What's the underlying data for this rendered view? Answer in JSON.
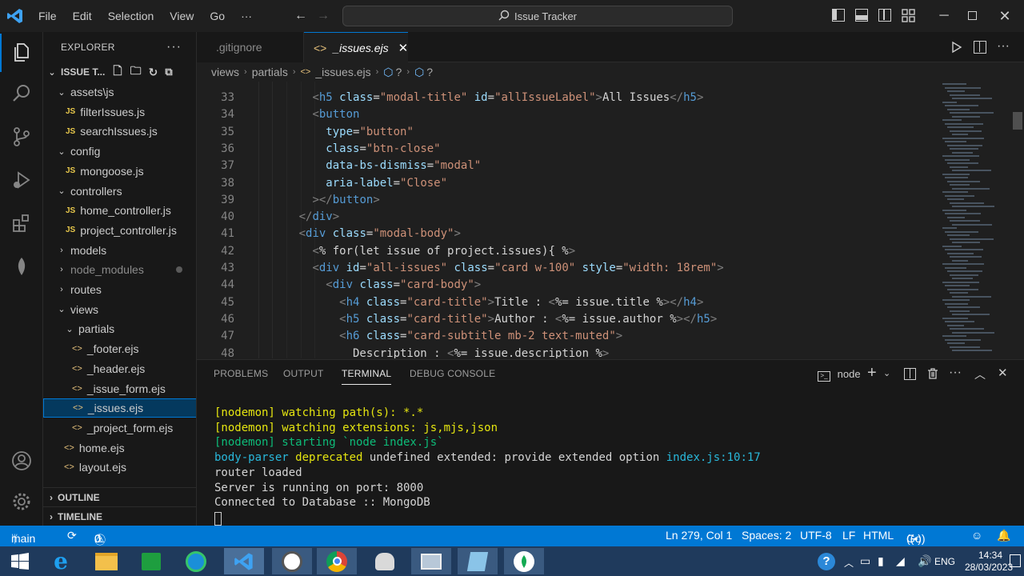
{
  "window": {
    "title": "Issue Tracker",
    "menu": [
      "File",
      "Edit",
      "Selection",
      "View",
      "Go",
      "···"
    ]
  },
  "explorer": {
    "header": "EXPLORER",
    "project": "ISSUE T...",
    "tree": [
      {
        "label": "assets\\js",
        "indent": 1,
        "kind": "folder-open"
      },
      {
        "label": "filterIssues.js",
        "indent": 2,
        "kind": "js"
      },
      {
        "label": "searchIssues.js",
        "indent": 2,
        "kind": "js"
      },
      {
        "label": "config",
        "indent": 1,
        "kind": "folder-open"
      },
      {
        "label": "mongoose.js",
        "indent": 2,
        "kind": "js"
      },
      {
        "label": "controllers",
        "indent": 1,
        "kind": "folder-open"
      },
      {
        "label": "home_controller.js",
        "indent": 2,
        "kind": "js"
      },
      {
        "label": "project_controller.js",
        "indent": 2,
        "kind": "js"
      },
      {
        "label": "models",
        "indent": 1,
        "kind": "folder-closed"
      },
      {
        "label": "node_modules",
        "indent": 1,
        "kind": "folder-closed-dim"
      },
      {
        "label": "routes",
        "indent": 1,
        "kind": "folder-closed"
      },
      {
        "label": "views",
        "indent": 1,
        "kind": "folder-open"
      },
      {
        "label": "partials",
        "indent": 2,
        "kind": "folder-open"
      },
      {
        "label": "_footer.ejs",
        "indent": 3,
        "kind": "ejs"
      },
      {
        "label": "_header.ejs",
        "indent": 3,
        "kind": "ejs"
      },
      {
        "label": "_issue_form.ejs",
        "indent": 3,
        "kind": "ejs"
      },
      {
        "label": "_issues.ejs",
        "indent": 3,
        "kind": "ejs-selected"
      },
      {
        "label": "_project_form.ejs",
        "indent": 3,
        "kind": "ejs"
      },
      {
        "label": "home.ejs",
        "indent": 2,
        "kind": "ejs"
      },
      {
        "label": "layout.ejs",
        "indent": 2,
        "kind": "ejs"
      }
    ],
    "outline": "OUTLINE",
    "timeline": "TIMELINE"
  },
  "tabs": [
    {
      "label": ".gitignore"
    },
    {
      "label": "_issues.ejs"
    }
  ],
  "breadcrumb": [
    "views",
    "partials",
    "_issues.ejs",
    "?",
    "?"
  ],
  "code": [
    {
      "n": "33",
      "parts": [
        [
          "tx",
          "        "
        ],
        [
          "br",
          "<"
        ],
        [
          "tg",
          "h5"
        ],
        [
          "at",
          " class"
        ],
        [
          "tx",
          "="
        ],
        [
          "st",
          "\"modal-title\""
        ],
        [
          "at",
          " id"
        ],
        [
          "tx",
          "="
        ],
        [
          "st",
          "\"allIssueLabel\""
        ],
        [
          "br",
          ">"
        ],
        [
          "tx",
          "All Issues"
        ],
        [
          "br",
          "</"
        ],
        [
          "tg",
          "h5"
        ],
        [
          "br",
          ">"
        ]
      ]
    },
    {
      "n": "34",
      "parts": [
        [
          "tx",
          "        "
        ],
        [
          "br",
          "<"
        ],
        [
          "tg",
          "button"
        ]
      ]
    },
    {
      "n": "35",
      "parts": [
        [
          "tx",
          "          "
        ],
        [
          "at",
          "type"
        ],
        [
          "tx",
          "="
        ],
        [
          "st",
          "\"button\""
        ]
      ]
    },
    {
      "n": "36",
      "parts": [
        [
          "tx",
          "          "
        ],
        [
          "at",
          "class"
        ],
        [
          "tx",
          "="
        ],
        [
          "st",
          "\"btn-close\""
        ]
      ]
    },
    {
      "n": "37",
      "parts": [
        [
          "tx",
          "          "
        ],
        [
          "at",
          "data-bs-dismiss"
        ],
        [
          "tx",
          "="
        ],
        [
          "st",
          "\"modal\""
        ]
      ]
    },
    {
      "n": "38",
      "parts": [
        [
          "tx",
          "          "
        ],
        [
          "at",
          "aria-label"
        ],
        [
          "tx",
          "="
        ],
        [
          "st",
          "\"Close\""
        ]
      ]
    },
    {
      "n": "39",
      "parts": [
        [
          "tx",
          "        "
        ],
        [
          "br",
          "></"
        ],
        [
          "tg",
          "button"
        ],
        [
          "br",
          ">"
        ]
      ]
    },
    {
      "n": "40",
      "parts": [
        [
          "tx",
          "      "
        ],
        [
          "br",
          "</"
        ],
        [
          "tg",
          "div"
        ],
        [
          "br",
          ">"
        ]
      ]
    },
    {
      "n": "41",
      "parts": [
        [
          "tx",
          "      "
        ],
        [
          "br",
          "<"
        ],
        [
          "tg",
          "div"
        ],
        [
          "at",
          " class"
        ],
        [
          "tx",
          "="
        ],
        [
          "st",
          "\"modal-body\""
        ],
        [
          "br",
          ">"
        ]
      ]
    },
    {
      "n": "42",
      "parts": [
        [
          "tx",
          "        "
        ],
        [
          "br",
          "<"
        ],
        [
          "tx",
          "% for(let issue of project.issues){ %"
        ],
        [
          "br",
          ">"
        ]
      ]
    },
    {
      "n": "43",
      "parts": [
        [
          "tx",
          "        "
        ],
        [
          "br",
          "<"
        ],
        [
          "tg",
          "div"
        ],
        [
          "at",
          " id"
        ],
        [
          "tx",
          "="
        ],
        [
          "st",
          "\"all-issues\""
        ],
        [
          "at",
          " class"
        ],
        [
          "tx",
          "="
        ],
        [
          "st",
          "\"card w-100\""
        ],
        [
          "at",
          " style"
        ],
        [
          "tx",
          "="
        ],
        [
          "st",
          "\"width: 18rem\""
        ],
        [
          "br",
          ">"
        ]
      ]
    },
    {
      "n": "44",
      "parts": [
        [
          "tx",
          "          "
        ],
        [
          "br",
          "<"
        ],
        [
          "tg",
          "div"
        ],
        [
          "at",
          " class"
        ],
        [
          "tx",
          "="
        ],
        [
          "st",
          "\"card-body\""
        ],
        [
          "br",
          ">"
        ]
      ]
    },
    {
      "n": "45",
      "parts": [
        [
          "tx",
          "            "
        ],
        [
          "br",
          "<"
        ],
        [
          "tg",
          "h4"
        ],
        [
          "at",
          " class"
        ],
        [
          "tx",
          "="
        ],
        [
          "st",
          "\"card-title\""
        ],
        [
          "br",
          ">"
        ],
        [
          "tx",
          "Title : "
        ],
        [
          "br",
          "<"
        ],
        [
          "tx",
          "%= issue.title %"
        ],
        [
          "br",
          "></"
        ],
        [
          "tg",
          "h4"
        ],
        [
          "br",
          ">"
        ]
      ]
    },
    {
      "n": "46",
      "parts": [
        [
          "tx",
          "            "
        ],
        [
          "br",
          "<"
        ],
        [
          "tg",
          "h5"
        ],
        [
          "at",
          " class"
        ],
        [
          "tx",
          "="
        ],
        [
          "st",
          "\"card-title\""
        ],
        [
          "br",
          ">"
        ],
        [
          "tx",
          "Author : "
        ],
        [
          "br",
          "<"
        ],
        [
          "tx",
          "%= issue.author %"
        ],
        [
          "br",
          "></"
        ],
        [
          "tg",
          "h5"
        ],
        [
          "br",
          ">"
        ]
      ]
    },
    {
      "n": "47",
      "parts": [
        [
          "tx",
          "            "
        ],
        [
          "br",
          "<"
        ],
        [
          "tg",
          "h6"
        ],
        [
          "at",
          " class"
        ],
        [
          "tx",
          "="
        ],
        [
          "st",
          "\"card-subtitle mb-2 text-muted\""
        ],
        [
          "br",
          ">"
        ]
      ]
    },
    {
      "n": "48",
      "parts": [
        [
          "tx",
          "              Description : "
        ],
        [
          "br",
          "<"
        ],
        [
          "tx",
          "%= issue.description %"
        ],
        [
          "br",
          ">"
        ]
      ]
    }
  ],
  "panel": {
    "tabs": [
      "PROBLEMS",
      "OUTPUT",
      "TERMINAL",
      "DEBUG CONSOLE"
    ],
    "active_tab": "TERMINAL",
    "shell": "node",
    "terminal": [
      {
        "parts": [
          [
            "yl",
            "[nodemon] watching path(s): *.*"
          ]
        ]
      },
      {
        "parts": [
          [
            "yl",
            "[nodemon] watching extensions: js,mjs,json"
          ]
        ]
      },
      {
        "parts": [
          [
            "gr",
            "[nodemon] starting `node index.js`"
          ]
        ]
      },
      {
        "parts": [
          [
            "cy",
            "body-parser"
          ],
          [
            "yl",
            " deprecated"
          ],
          [
            "tx",
            " undefined extended: provide extended option "
          ],
          [
            "cy",
            "index.js:10:17"
          ]
        ]
      },
      {
        "parts": [
          [
            "tx",
            "router loaded"
          ]
        ]
      },
      {
        "parts": [
          [
            "tx",
            "Server is running on port: 8000"
          ]
        ]
      },
      {
        "parts": [
          [
            "tx",
            "Connected to Database :: MongoDB"
          ]
        ]
      }
    ]
  },
  "statusbar": {
    "branch": "main",
    "errors": "0",
    "warnings": "0",
    "position": "Ln 279, Col 1",
    "spaces": "Spaces: 2",
    "encoding": "UTF-8",
    "eol": "LF",
    "language": "HTML",
    "golive": "Go Live"
  },
  "taskbar": {
    "lang": "ENG",
    "time": "14:34",
    "date": "28/03/2023"
  },
  "colors": {
    "accent": "#0078d4",
    "statusbar": "#0078d4",
    "editor_bg": "#1f1f1f"
  }
}
